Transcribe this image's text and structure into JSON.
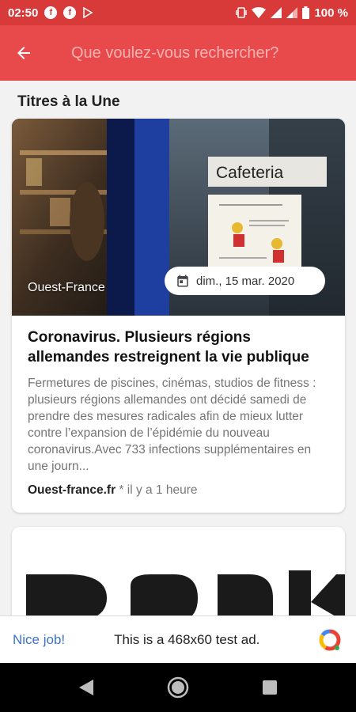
{
  "status_bar": {
    "time": "02:50",
    "battery": "100 %",
    "icons": [
      "facebook-icon",
      "facebook-icon",
      "play-store-icon",
      "vibrate-icon",
      "wifi-icon",
      "signal-icon",
      "signal-icon",
      "battery-icon"
    ]
  },
  "app_bar": {
    "search_placeholder": "Que voulez-vous rechercher?",
    "background": "#e8494a"
  },
  "section": {
    "title": "Titres à la Une"
  },
  "article": {
    "image_source_label": "Ouest-France",
    "image_sign_text": "Cafeteria",
    "date": "dim., 15 mar. 2020",
    "title": "Coronavirus. Plusieurs régions allemandes restreignent la vie publique",
    "description": "Fermetures de piscines, cinémas, studios de fitness : plusieurs régions allemandes ont décidé samedi de prendre des mesures radicales afin de mieux lutter contre l’expansion de l’épidémie du nouveau coronavirus.Avec 733 infections supplémentaires en une journ...",
    "source": "Ouest-france.fr",
    "time_ago": " * il y a 1 heure"
  },
  "ad": {
    "nice_job": "Nice job!",
    "text": "This is a 468x60 test ad."
  }
}
